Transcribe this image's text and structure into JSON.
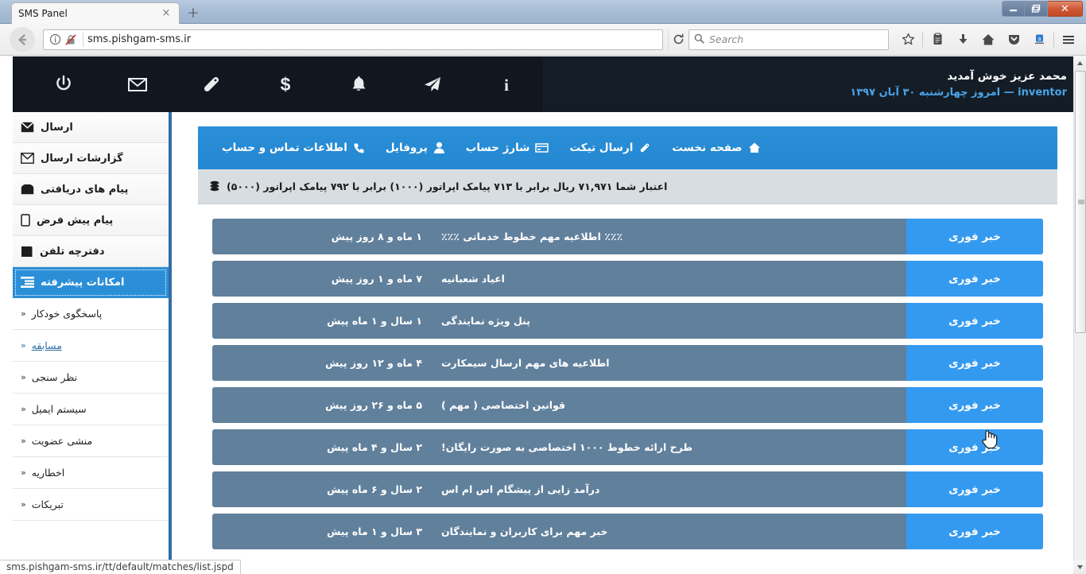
{
  "browser": {
    "tab_title": "SMS Panel",
    "tab_close_label": "×",
    "new_tab_label": "+",
    "back_icon": "back-arrow-icon",
    "url": "sms.pishgam-sms.ir",
    "reload_label": "↻",
    "search_placeholder": "Search",
    "window_minimize": "—",
    "window_maximize": "❐",
    "window_close": "✕",
    "status_url": "sms.pishgam-sms.ir/tt/default/matches/list.jspd"
  },
  "header": {
    "icons": [
      {
        "name": "power-icon",
        "glyph": "power"
      },
      {
        "name": "envelope-icon",
        "glyph": "envelope"
      },
      {
        "name": "ticket-icon",
        "glyph": "ticket"
      },
      {
        "name": "dollar-icon",
        "glyph": "dollar"
      },
      {
        "name": "bell-icon",
        "glyph": "bell"
      },
      {
        "name": "paper-plane-icon",
        "glyph": "plane"
      },
      {
        "name": "info-icon",
        "glyph": "info"
      }
    ],
    "greeting": "محمد عزیز خوش آمدید",
    "subline": "inventor — امروز چهارشنبه ۳۰ آبان ۱۳۹۷"
  },
  "sidebar": {
    "items": [
      {
        "label": "ارسال",
        "icon": "envelope-filled-icon",
        "active": false
      },
      {
        "label": "گزارشات ارسال",
        "icon": "envelope-outline-icon",
        "active": false
      },
      {
        "label": "پیام های دریافتی",
        "icon": "inbox-icon",
        "active": false
      },
      {
        "label": "پیام پیش فرض",
        "icon": "mobile-icon",
        "active": false
      },
      {
        "label": "دفترچه تلفن",
        "icon": "book-icon",
        "active": false
      },
      {
        "label": "امکانات پیشرفته",
        "icon": "list-icon",
        "active": true
      }
    ],
    "sub_items": [
      {
        "label": "پاسخگوی خودکار",
        "hovered": false
      },
      {
        "label": "مسابقه",
        "hovered": true
      },
      {
        "label": "نظر سنجی",
        "hovered": false
      },
      {
        "label": "سیستم ایمیل",
        "hovered": false
      },
      {
        "label": "منشی عضویت",
        "hovered": false
      },
      {
        "label": "اخطاریه",
        "hovered": false
      },
      {
        "label": "تبریکات",
        "hovered": false
      }
    ],
    "chevron": "«"
  },
  "nav": {
    "items": [
      {
        "label": "صفحه نخست",
        "icon": "home-icon"
      },
      {
        "label": "ارسال تیکت",
        "icon": "ticket-icon"
      },
      {
        "label": "شارژ حساب",
        "icon": "card-icon"
      },
      {
        "label": "پروفایل",
        "icon": "user-icon"
      },
      {
        "label": "اطلاعات تماس و حساب",
        "icon": "phone-icon"
      }
    ]
  },
  "credit": {
    "icon": "coins-icon",
    "text": "اعتبار شما ۷۱,۹۷۱ ریال برابر با ۷۱۳ پیامک اپراتور (۱۰۰۰) برابر با ۷۹۲ پیامک اپراتور (۵۰۰۰)"
  },
  "news": {
    "badge_label": "خبر فوری",
    "rows": [
      {
        "title": "٪٪٪ اطلاعیه مهم خطوط خدماتی ٪٪٪",
        "time": "۱ ماه و ۸ روز پیش"
      },
      {
        "title": "اعیاد شعبانیه",
        "time": "۷ ماه و ۱ روز پیش"
      },
      {
        "title": "پنل ویژه نمایندگی",
        "time": "۱ سال و ۱ ماه پیش"
      },
      {
        "title": "اطلاعیه های مهم ارسال سیمکارت",
        "time": "۴ ماه و ۱۲ روز پیش"
      },
      {
        "title": "قوانین اختصاصی ( مهم )",
        "time": "۵ ماه و ۲۶ روز پیش"
      },
      {
        "title": "طرح ارائه خطوط ۱۰۰۰ اختصاصی به صورت رایگان!",
        "time": "۲ سال و ۴ ماه پیش"
      },
      {
        "title": "درآمد زایی از پیشگام اس ام اس",
        "time": "۲ سال و ۶ ماه پیش"
      },
      {
        "title": "خبر مهم برای کاربران و نمایندگان",
        "time": "۳ سال و ۱ ماه پیش"
      }
    ]
  },
  "colors": {
    "accent_blue": "#2b8fd8",
    "badge_blue": "#349af0",
    "row_slate": "#61809c",
    "header_dark": "#141d26",
    "sidebar_border": "#2f6ea5",
    "credit_bg": "#d8dde1"
  }
}
